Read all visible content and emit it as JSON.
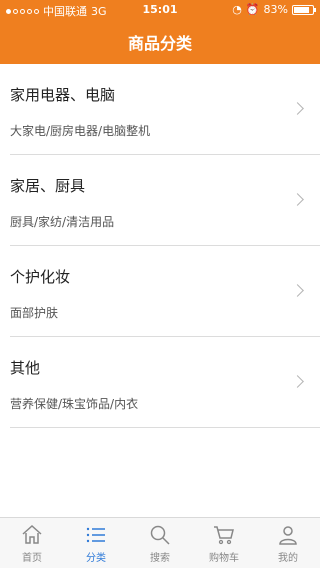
{
  "status": {
    "carrier": "中国联通",
    "network": "3G",
    "time": "15:01",
    "battery": "83%",
    "battery_level": 0.83
  },
  "header": {
    "title": "商品分类"
  },
  "categories": [
    {
      "title": "家用电器、电脑",
      "subtitle": "大家电/厨房电器/电脑整机"
    },
    {
      "title": "家居、厨具",
      "subtitle": "厨具/家纺/清洁用品"
    },
    {
      "title": "个护化妆",
      "subtitle": "面部护肤"
    },
    {
      "title": "其他",
      "subtitle": "营养保健/珠宝饰品/内衣"
    }
  ],
  "tabs": [
    {
      "label": "首页",
      "icon": "home-icon"
    },
    {
      "label": "分类",
      "icon": "list-icon",
      "active": true
    },
    {
      "label": "搜索",
      "icon": "search-icon"
    },
    {
      "label": "购物车",
      "icon": "cart-icon"
    },
    {
      "label": "我的",
      "icon": "user-icon"
    }
  ],
  "colors": {
    "accent": "#ef7f1f",
    "active_tab": "#2f7ad8"
  }
}
